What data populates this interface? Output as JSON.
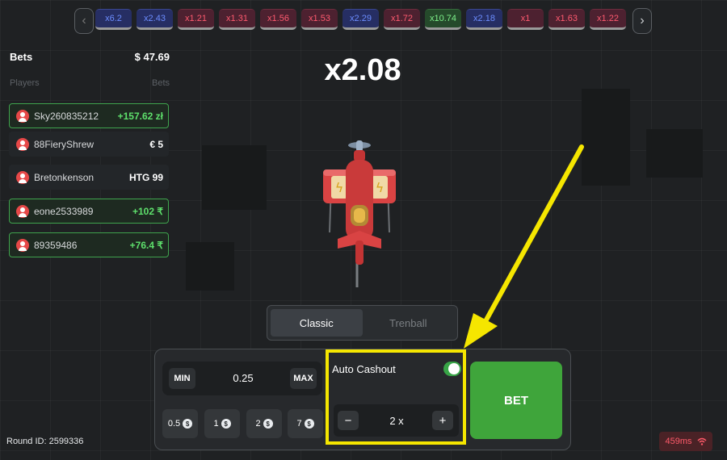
{
  "history": {
    "prev_label": "‹",
    "next_label": "›",
    "items": [
      {
        "value": "x6.2",
        "tone": "blue"
      },
      {
        "value": "x2.43",
        "tone": "blue"
      },
      {
        "value": "x1.21",
        "tone": "red"
      },
      {
        "value": "x1.31",
        "tone": "red"
      },
      {
        "value": "x1.56",
        "tone": "red"
      },
      {
        "value": "x1.53",
        "tone": "red"
      },
      {
        "value": "x2.29",
        "tone": "blue"
      },
      {
        "value": "x1.72",
        "tone": "red"
      },
      {
        "value": "x10.74",
        "tone": "green"
      },
      {
        "value": "x2.18",
        "tone": "blue"
      },
      {
        "value": "x1",
        "tone": "red"
      },
      {
        "value": "x1.63",
        "tone": "red"
      },
      {
        "value": "x1.22",
        "tone": "red"
      }
    ]
  },
  "bets": {
    "title": "Bets",
    "total": "$ 47.69",
    "col_players": "Players",
    "col_bets": "Bets",
    "players": [
      {
        "name": "Sky260835212",
        "amount": "+157.62 zł",
        "won": true
      },
      {
        "name": "88FieryShrew",
        "amount": "€ 5",
        "won": false
      },
      {
        "name": "Bretonkenson",
        "amount": "HTG 99",
        "won": false
      },
      {
        "name": "eone2533989",
        "amount": "+102 ₹",
        "won": true
      },
      {
        "name": "89359486",
        "amount": "+76.4 ₹",
        "won": true
      }
    ]
  },
  "game": {
    "multiplier": "x2.08"
  },
  "modes": {
    "classic": "Classic",
    "trenball": "Trenball",
    "active": "Classic"
  },
  "bet_panel": {
    "min_label": "MIN",
    "max_label": "MAX",
    "amount": "0.25",
    "quick_amounts": [
      "0.5",
      "1",
      "2",
      "7"
    ],
    "coin_symbol": "$",
    "auto_cashout_label": "Auto Cashout",
    "auto_cashout_enabled": true,
    "cashout_value": "2 x",
    "minus_label": "−",
    "plus_label": "+",
    "bet_label": "BET"
  },
  "footer": {
    "round_id": "Round ID: 2599336",
    "latency": "459ms"
  },
  "colors": {
    "accent_green": "#3fa53b",
    "highlight_yellow": "#f5e600",
    "win_green": "#5ee06c"
  }
}
